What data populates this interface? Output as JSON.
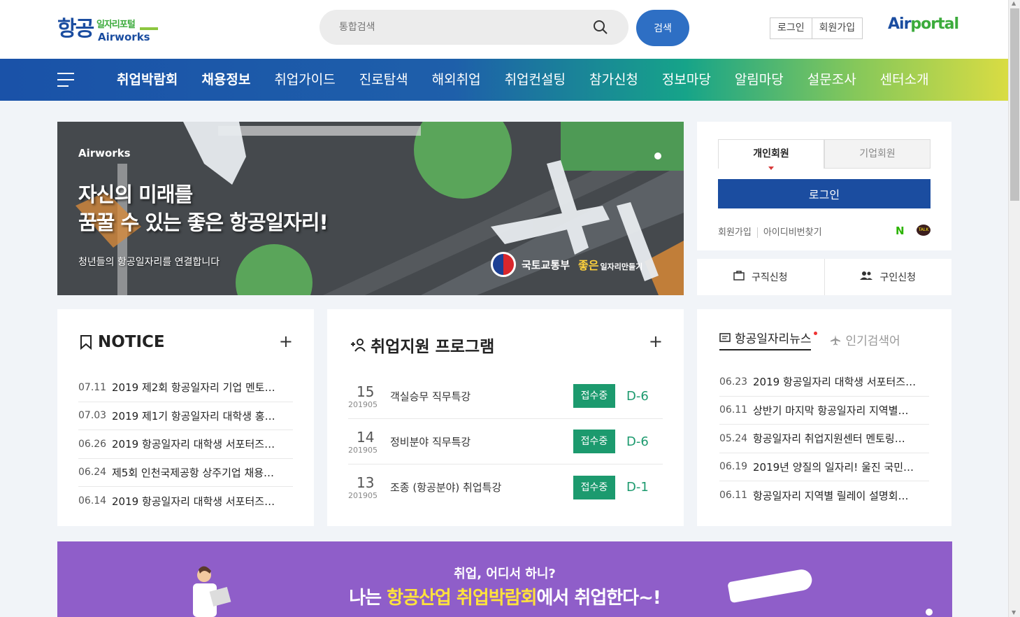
{
  "header": {
    "logo_main": "항공",
    "logo_sub": "일자리포털",
    "logo_en": "Airworks",
    "search_placeholder": "통합검색",
    "search_button": "검색",
    "login": "로그인",
    "signup": "회원가입",
    "airportal_a": "Air",
    "airportal_b": "portal"
  },
  "nav": {
    "items": [
      "취업박람회",
      "채용정보",
      "취업가이드",
      "진로탐색",
      "해외취업",
      "취업컨설팅",
      "참가신청",
      "정보마당",
      "알림마당",
      "설문조사",
      "센터소개"
    ]
  },
  "hero": {
    "brand": "Airworks",
    "title_line1": "자신의 미래를",
    "title_line2": "꿈꿀 수 있는 좋은 항공일자리!",
    "subtitle": "청년들의 항공일자리를 연결합니다",
    "ministry": "국토교통부",
    "jobs_brand": "좋은",
    "jobs_small": "일자리만들기"
  },
  "login_panel": {
    "tab_personal": "개인회원",
    "tab_company": "기업회원",
    "login_button": "로그인",
    "link_signup": "회원가입",
    "link_find": "아이디비번찾기",
    "naver": "N",
    "kakao": "TALK"
  },
  "apply": {
    "job_seek": "구직신청",
    "job_offer": "구인신청"
  },
  "notice": {
    "title": "NOTICE",
    "plus": "+",
    "rows": [
      {
        "date": "07.11",
        "title": "2019 제2회 항공일자리 기업 멘토…"
      },
      {
        "date": "07.03",
        "title": "2019 제1기 항공일자리 대학생 홍…"
      },
      {
        "date": "06.26",
        "title": "2019 항공일자리 대학생 서포터즈…"
      },
      {
        "date": "06.24",
        "title": "제5회 인천국제공항 상주기업 채용…"
      },
      {
        "date": "06.14",
        "title": "2019 항공일자리 대학생 서포터즈…"
      }
    ]
  },
  "program": {
    "title": "취업지원 프로그램",
    "plus": "+",
    "rows": [
      {
        "day": "15",
        "ym": "201905",
        "name": "객실승무 직무특강",
        "status": "접수중",
        "dday": "D-6"
      },
      {
        "day": "14",
        "ym": "201905",
        "name": "정비분야 직무특강",
        "status": "접수중",
        "dday": "D-6"
      },
      {
        "day": "13",
        "ym": "201905",
        "name": "조종 (항공분야) 취업특강",
        "status": "접수중",
        "dday": "D-1"
      }
    ]
  },
  "news": {
    "tab_news": "항공일자리뉴스",
    "tab_popular": "인기검색어",
    "rows": [
      {
        "date": "06.23",
        "title": "2019 항공일자리 대학생 서포터즈…"
      },
      {
        "date": "06.11",
        "title": "상반기 마지막 항공일자리 지역별…"
      },
      {
        "date": "05.24",
        "title": "항공일자리 취업지원센터 멘토링…"
      },
      {
        "date": "06.19",
        "title": "2019년 양질의 일자리! 울진 국민…"
      },
      {
        "date": "06.11",
        "title": "항공일자리 지역별 릴레이 설명회…"
      }
    ]
  },
  "banner": {
    "top": "취업, 어디서 하니?",
    "main_pre": "나는 ",
    "main_hl": "항공산업 취업박람회",
    "main_post": "에서 취업한다~!"
  },
  "colors": {
    "brand_blue": "#1b4da0",
    "accent_green": "#1c9a6e",
    "banner_purple": "#8f5ec9"
  }
}
